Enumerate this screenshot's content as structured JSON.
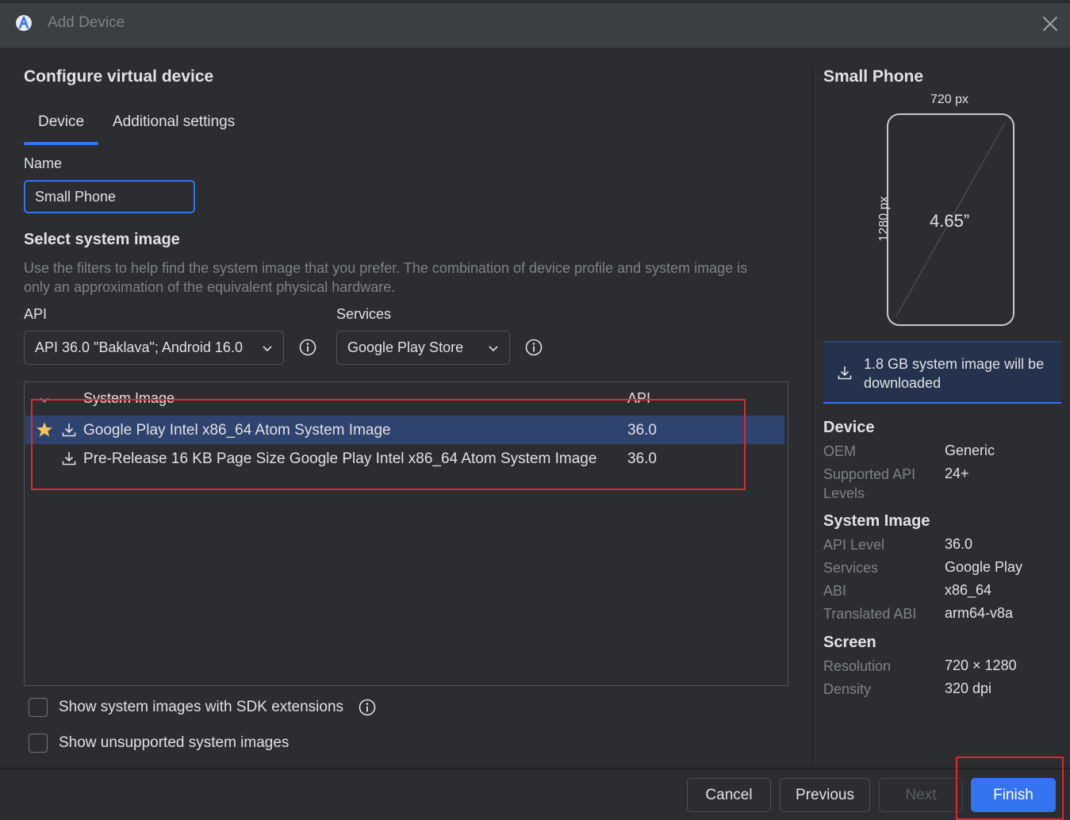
{
  "window": {
    "title": "Add Device"
  },
  "left": {
    "heading": "Configure virtual device",
    "tabs": [
      {
        "label": "Device",
        "active": true
      },
      {
        "label": "Additional settings",
        "active": false
      }
    ],
    "name": {
      "label": "Name",
      "value": "Small Phone"
    },
    "system_image": {
      "heading": "Select system image",
      "hint": "Use the filters to help find the system image that you prefer. The combination of device profile and system image is only an approximation of the equivalent physical hardware.",
      "api": {
        "label": "API",
        "selected": "API 36.0 \"Baklava\"; Android 16.0"
      },
      "services": {
        "label": "Services",
        "selected": "Google Play Store"
      }
    },
    "table": {
      "columns": {
        "name": "System Image",
        "api": "API"
      },
      "rows": [
        {
          "name": "Google Play Intel x86_64 Atom System Image",
          "api": "36.0",
          "recommended": true,
          "selected": true
        },
        {
          "name": "Pre-Release 16 KB Page Size Google Play Intel x86_64 Atom System Image",
          "api": "36.0",
          "recommended": false,
          "selected": false
        }
      ]
    },
    "checkboxes": [
      {
        "label": "Show system images with SDK extensions",
        "checked": false
      },
      {
        "label": "Show unsupported system images",
        "checked": false
      }
    ]
  },
  "right": {
    "device_name": "Small Phone",
    "preview": {
      "width": "720 px",
      "height": "1280 px",
      "diagonal": "4.65”"
    },
    "download_notice": "1.8 GB system image will be downloaded",
    "device": {
      "title": "Device",
      "oem_label": "OEM",
      "oem_value": "Generic",
      "api_levels_label": "Supported API Levels",
      "api_levels_value": "24+"
    },
    "system_image": {
      "title": "System Image",
      "api_level_label": "API Level",
      "api_level_value": "36.0",
      "services_label": "Services",
      "services_value": "Google Play",
      "abi_label": "ABI",
      "abi_value": "x86_64",
      "translated_abi_label": "Translated ABI",
      "translated_abi_value": "arm64-v8a"
    },
    "screen": {
      "title": "Screen",
      "resolution_label": "Resolution",
      "resolution_value": "720 × 1280",
      "density_label": "Density",
      "density_value": "320 dpi"
    }
  },
  "footer": {
    "cancel": "Cancel",
    "previous": "Previous",
    "next": "Next",
    "finish": "Finish"
  },
  "colors": {
    "accent": "#3574f0",
    "background": "#2b2d30",
    "titlebar": "#3c3f41",
    "selection": "#2e436e",
    "annotation": "#e0282e",
    "star": "#f2c55c"
  }
}
